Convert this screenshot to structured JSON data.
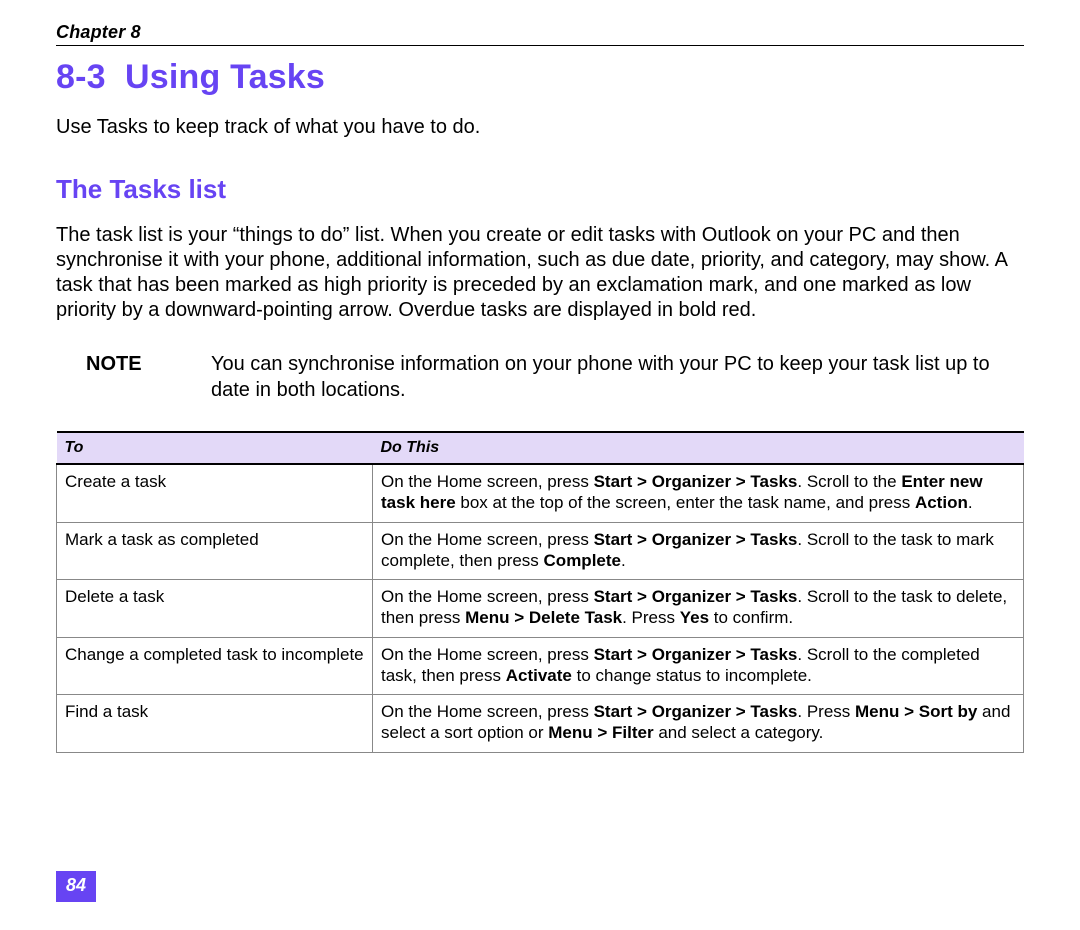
{
  "header": {
    "chapter": "Chapter 8"
  },
  "section": {
    "number": "8-3",
    "title": "Using Tasks",
    "intro": "Use Tasks to keep track of what you have to do."
  },
  "subsection": {
    "title": "The Tasks list",
    "body": "The task list is your “things to do” list. When you create or edit tasks with Outlook on your PC and then synchronise it with your phone, additional information, such as due date, priority, and category, may show. A task that has been marked as high priority is preceded by an exclamation mark, and one marked as low priority by a downward-pointing arrow. Overdue tasks are displayed in bold red."
  },
  "note": {
    "label": "NOTE",
    "text": "You can synchronise information on your phone with your PC to keep your task list up to date in both locations."
  },
  "table": {
    "headers": {
      "to": "To",
      "do": "Do This"
    },
    "rows": [
      {
        "to": "Create a task",
        "do_segments": [
          {
            "t": "On the Home screen, press ",
            "b": false
          },
          {
            "t": "Start > Organizer > Tasks",
            "b": true
          },
          {
            "t": ". Scroll to the ",
            "b": false
          },
          {
            "t": "Enter new task here",
            "b": true
          },
          {
            "t": " box at the top of the screen, enter the task name, and press ",
            "b": false
          },
          {
            "t": "Action",
            "b": true
          },
          {
            "t": ".",
            "b": false
          }
        ]
      },
      {
        "to": "Mark a task as completed",
        "do_segments": [
          {
            "t": "On the Home screen, press ",
            "b": false
          },
          {
            "t": "Start > Organizer > Tasks",
            "b": true
          },
          {
            "t": ". Scroll to the task to mark complete, then press ",
            "b": false
          },
          {
            "t": "Complete",
            "b": true
          },
          {
            "t": ".",
            "b": false
          }
        ]
      },
      {
        "to": "Delete a task",
        "do_segments": [
          {
            "t": "On the Home screen, press ",
            "b": false
          },
          {
            "t": "Start > Organizer > Tasks",
            "b": true
          },
          {
            "t": ". Scroll to the task to delete, then press ",
            "b": false
          },
          {
            "t": "Menu > Delete Task",
            "b": true
          },
          {
            "t": ". Press ",
            "b": false
          },
          {
            "t": "Yes",
            "b": true
          },
          {
            "t": " to confirm.",
            "b": false
          }
        ]
      },
      {
        "to": "Change a completed task to incomplete",
        "do_segments": [
          {
            "t": "On the Home screen, press ",
            "b": false
          },
          {
            "t": "Start > Organizer > Tasks",
            "b": true
          },
          {
            "t": ". Scroll to the completed task, then press ",
            "b": false
          },
          {
            "t": "Activate",
            "b": true
          },
          {
            "t": " to change status to incomplete.",
            "b": false
          }
        ]
      },
      {
        "to": "Find a task",
        "do_segments": [
          {
            "t": "On the Home screen, press ",
            "b": false
          },
          {
            "t": "Start > Organizer > Tasks",
            "b": true
          },
          {
            "t": ". Press ",
            "b": false
          },
          {
            "t": "Menu > Sort by",
            "b": true
          },
          {
            "t": " and select a sort option or ",
            "b": false
          },
          {
            "t": "Menu > Filter",
            "b": true
          },
          {
            "t": " and select a category.",
            "b": false
          }
        ]
      }
    ]
  },
  "footer": {
    "page": "84"
  }
}
